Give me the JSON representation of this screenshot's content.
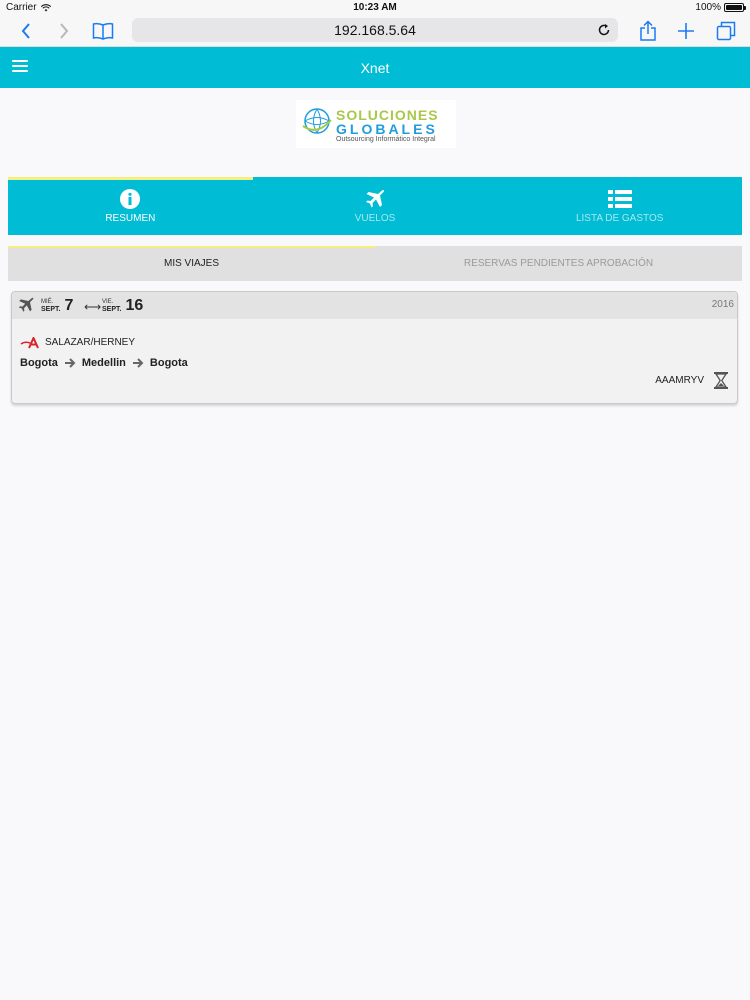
{
  "status_bar": {
    "carrier": "Carrier",
    "time": "10:23 AM",
    "battery": "100%"
  },
  "browser": {
    "url": "192.168.5.64"
  },
  "app": {
    "title": "Xnet"
  },
  "logo": {
    "line1": "SOLUCIONES",
    "line2": "GLOBALES",
    "line3": "Outsourcing Informático Integral"
  },
  "main_tabs": [
    {
      "label": "RESUMEN",
      "icon": "info-icon",
      "active": true
    },
    {
      "label": "VUELOS",
      "icon": "plane-icon",
      "active": false
    },
    {
      "label": "LISTA DE GASTOS",
      "icon": "list-icon",
      "active": false
    }
  ],
  "sub_tabs": [
    {
      "label": "MIS VIAJES",
      "active": true
    },
    {
      "label": "RESERVAS PENDIENTES APROBACIÓN",
      "active": false
    }
  ],
  "trip": {
    "depart": {
      "weekday": "MIÉ.",
      "month": "SEPT.",
      "day": "7"
    },
    "return": {
      "weekday": "VIE.",
      "month": "SEPT.",
      "day": "16"
    },
    "year": "2016",
    "passenger": "SALAZAR/HERNEY",
    "route": [
      "Bogota",
      "Medellin",
      "Bogota"
    ],
    "locator": "AAAMRYV",
    "status_icon": "hourglass-icon"
  },
  "colors": {
    "primary": "#00bcd4",
    "active_indicator": "#f5ef80"
  }
}
